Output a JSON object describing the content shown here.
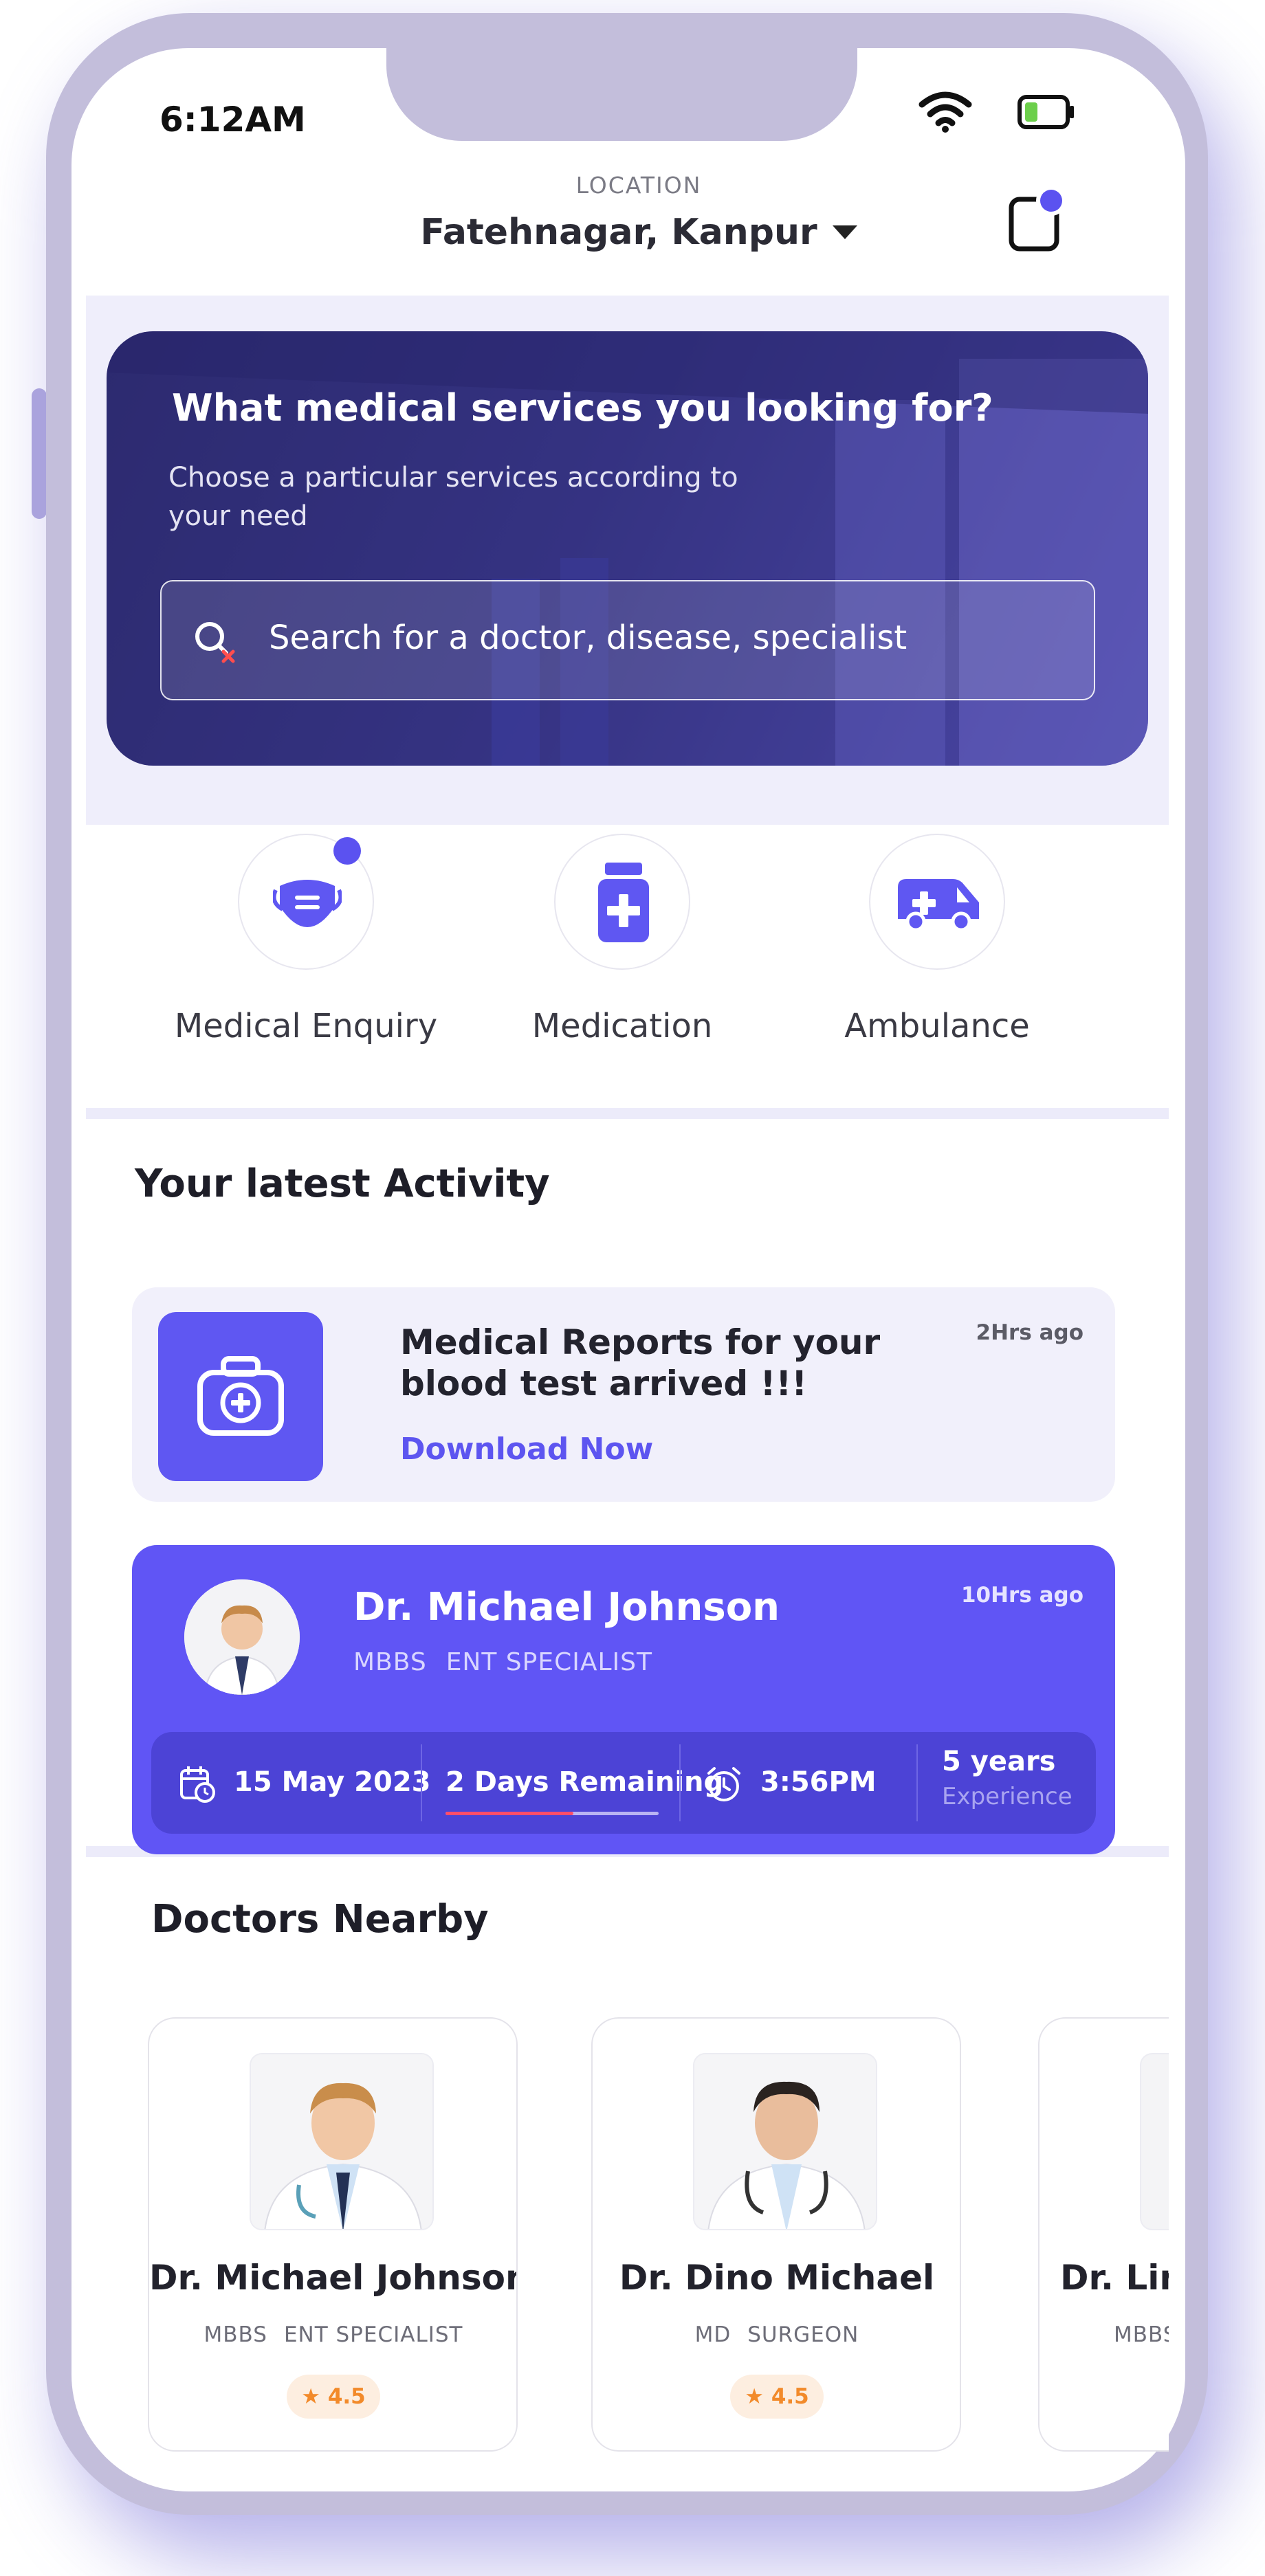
{
  "status_bar": {
    "time": "6:12AM"
  },
  "location": {
    "label": "LOCATION",
    "value": "Fatehnagar, Kanpur"
  },
  "hero": {
    "title": "What medical services you looking for?",
    "subtitle": "Choose a particular services according to your need",
    "search_placeholder": "Search for a doctor, disease, specialist"
  },
  "services": [
    {
      "label": "Medical Enquiry",
      "icon": "mask-icon"
    },
    {
      "label": "Medication",
      "icon": "medicine-bottle-icon"
    },
    {
      "label": "Ambulance",
      "icon": "ambulance-icon"
    }
  ],
  "activity": {
    "heading": "Your latest Activity",
    "report": {
      "title": "Medical Reports for your blood test arrived !!!",
      "action": "Download Now",
      "time": "2Hrs ago",
      "icon": "medical-kit-icon"
    },
    "appointment": {
      "doctor": "Dr. Michael Johnson",
      "degree": "MBBS",
      "specialty": "ENT SPECIALIST",
      "time": "10Hrs ago",
      "date": "15 May 2023",
      "remaining": "2 Days Remaining",
      "remaining_progress": 0.6,
      "clock": "3:56PM",
      "experience_value": "5 years",
      "experience_label": "Experience"
    }
  },
  "nearby": {
    "heading": "Doctors Nearby",
    "doctors": [
      {
        "name": "Dr. Michael Johnson",
        "degree": "MBBS",
        "specialty": "ENT SPECIALIST",
        "rating": "4.5"
      },
      {
        "name": "Dr. Dino Michael",
        "degree": "MD",
        "specialty": "SURGEON",
        "rating": "4.5"
      },
      {
        "name": "Dr. Lin",
        "degree": "MBBS",
        "specialty": "",
        "rating": ""
      }
    ]
  },
  "colors": {
    "accent": "#5f57f2",
    "accent_dark": "#4c43d6",
    "frame": "#c3bedb",
    "rating_bg": "#fdeee0",
    "rating_fg": "#f28a2a",
    "progress_red": "#ff4d6a"
  }
}
